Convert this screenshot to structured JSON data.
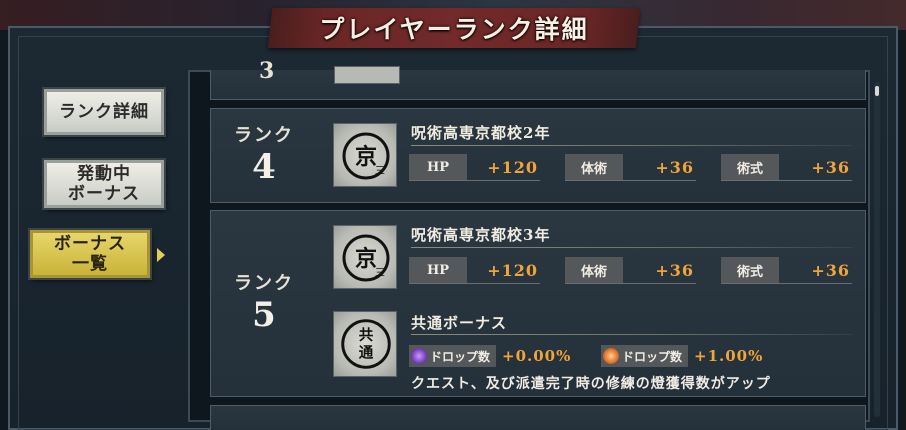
{
  "header": {
    "title": "プレイヤーランク詳細"
  },
  "sidebar": {
    "items": [
      {
        "label": "ランク詳細",
        "active": false
      },
      {
        "label": "発動中\nボーナス",
        "active": false
      },
      {
        "label": "ボーナス\n一覧",
        "active": true
      }
    ]
  },
  "ranks": [
    {
      "rank_label": "ランク",
      "rank_number": "4",
      "entries": [
        {
          "title": "呪術高専京都校2年",
          "emblem": "kyoto-school-emblem",
          "stats": [
            {
              "label": "HP",
              "value": "+120"
            },
            {
              "label": "体術",
              "value": "+36"
            },
            {
              "label": "術式",
              "value": "+36"
            }
          ]
        }
      ]
    },
    {
      "rank_label": "ランク",
      "rank_number": "5",
      "entries": [
        {
          "title": "呪術高専京都校3年",
          "emblem": "kyoto-school-emblem",
          "stats": [
            {
              "label": "HP",
              "value": "+120"
            },
            {
              "label": "体術",
              "value": "+36"
            },
            {
              "label": "術式",
              "value": "+36"
            }
          ]
        }
      ],
      "common_bonus": {
        "title": "共通ボーナス",
        "emblem_text": "共通",
        "chips": [
          {
            "label": "ドロップ数",
            "value": "+0.00%",
            "icon": "purple-orb-icon",
            "color": "#8a4fd0"
          },
          {
            "label": "ドロップ数",
            "value": "+1.00%",
            "icon": "orange-orb-icon",
            "color": "#e0702a"
          }
        ],
        "description": "クエスト、及び派遣完了時の修練の燈獲得数がアップ"
      }
    }
  ],
  "colors": {
    "accent_value": "#f0a43a",
    "active_button": "#d8c24a",
    "title_banner": "#6a2626"
  }
}
